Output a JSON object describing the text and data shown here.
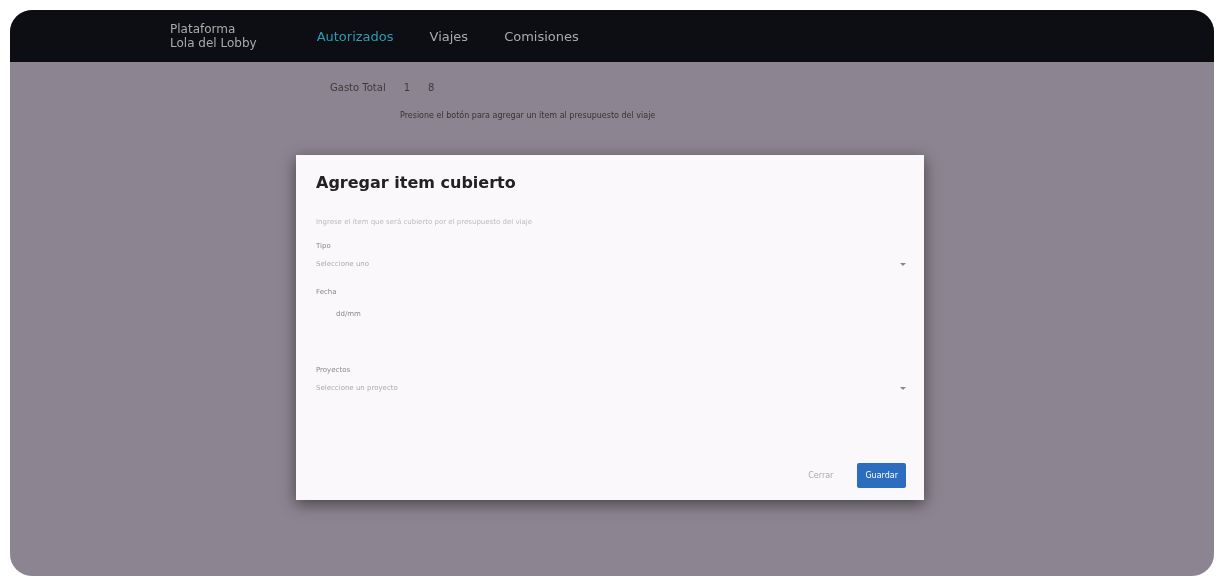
{
  "app": {
    "brand_line_1": "Plataforma",
    "brand_line_2": "Lola del Lobby"
  },
  "nav": [
    {
      "label": "Autorizados",
      "selected": true
    },
    {
      "label": "Viajes",
      "selected": false
    },
    {
      "label": "Comisiones",
      "selected": false
    }
  ],
  "page": {
    "total_label": "Gasto Total",
    "total_values": [
      "1",
      "8"
    ],
    "note": "Presione el botón para agregar un ítem al presupuesto del viaje"
  },
  "dialog": {
    "title": "Agregar item cubierto",
    "intro": "Ingrese el ítem que será cubierto por el presupuesto del viaje",
    "fields": [
      {
        "kind": "select",
        "label": "Tipo",
        "placeholder": "Seleccione uno"
      },
      {
        "kind": "date",
        "label": "Fecha",
        "placeholder": "dd/mm"
      },
      {
        "kind": "select",
        "label": "Proyectos",
        "placeholder": "Seleccione un proyecto"
      }
    ],
    "buttons": [
      {
        "kind": "flat",
        "label": "Cerrar"
      },
      {
        "kind": "primary",
        "label": "Guardar"
      }
    ]
  }
}
